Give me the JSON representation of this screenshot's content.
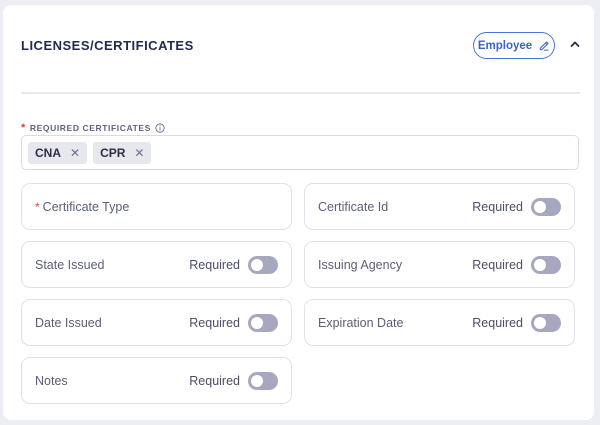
{
  "section": {
    "title": "LICENSES/CERTIFICATES",
    "employee_button": "Employee",
    "collapse_icon": "chevron-up-icon",
    "edit_icon": "pencil-icon"
  },
  "required_certificates": {
    "label": "REQUIRED CERTIFICATES",
    "required_marker": "*",
    "info_icon": "info-icon",
    "tags": [
      "CNA",
      "CPR"
    ],
    "remove_glyph": "✕"
  },
  "fields": [
    {
      "name": "Certificate Type",
      "required_marker": "*",
      "toggle": null
    },
    {
      "name": "Certificate Id",
      "toggle_label": "Required",
      "toggle_on": false
    },
    {
      "name": "State Issued",
      "toggle_label": "Required",
      "toggle_on": false
    },
    {
      "name": "Issuing Agency",
      "toggle_label": "Required",
      "toggle_on": false
    },
    {
      "name": "Date Issued",
      "toggle_label": "Required",
      "toggle_on": false
    },
    {
      "name": "Expiration Date",
      "toggle_label": "Required",
      "toggle_on": false
    },
    {
      "name": "Notes",
      "toggle_label": "Required",
      "toggle_on": false
    }
  ],
  "colors": {
    "accent": "#3a63c9",
    "required_star": "#e0433d",
    "toggle_off": "#a7a7c0",
    "title": "#232a4e"
  }
}
